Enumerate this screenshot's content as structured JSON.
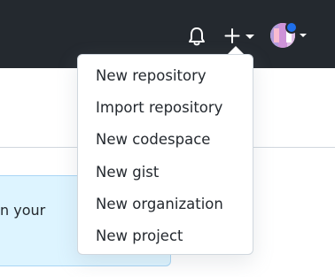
{
  "header": {
    "bell_icon": "bell-icon",
    "create_icon": "plus-icon",
    "create_caret_icon": "caret-down-icon",
    "avatar_icon": "avatar",
    "colors": {
      "header_bg": "#24292f",
      "status_dot": "#1f6feb"
    }
  },
  "create_menu": {
    "items": [
      {
        "label": "New repository"
      },
      {
        "label": "Import repository"
      },
      {
        "label": "New codespace"
      },
      {
        "label": "New gist"
      },
      {
        "label": "New organization"
      },
      {
        "label": "New project"
      }
    ]
  },
  "banner": {
    "text_fragment": "n your",
    "bg_color": "#ddf4ff"
  }
}
